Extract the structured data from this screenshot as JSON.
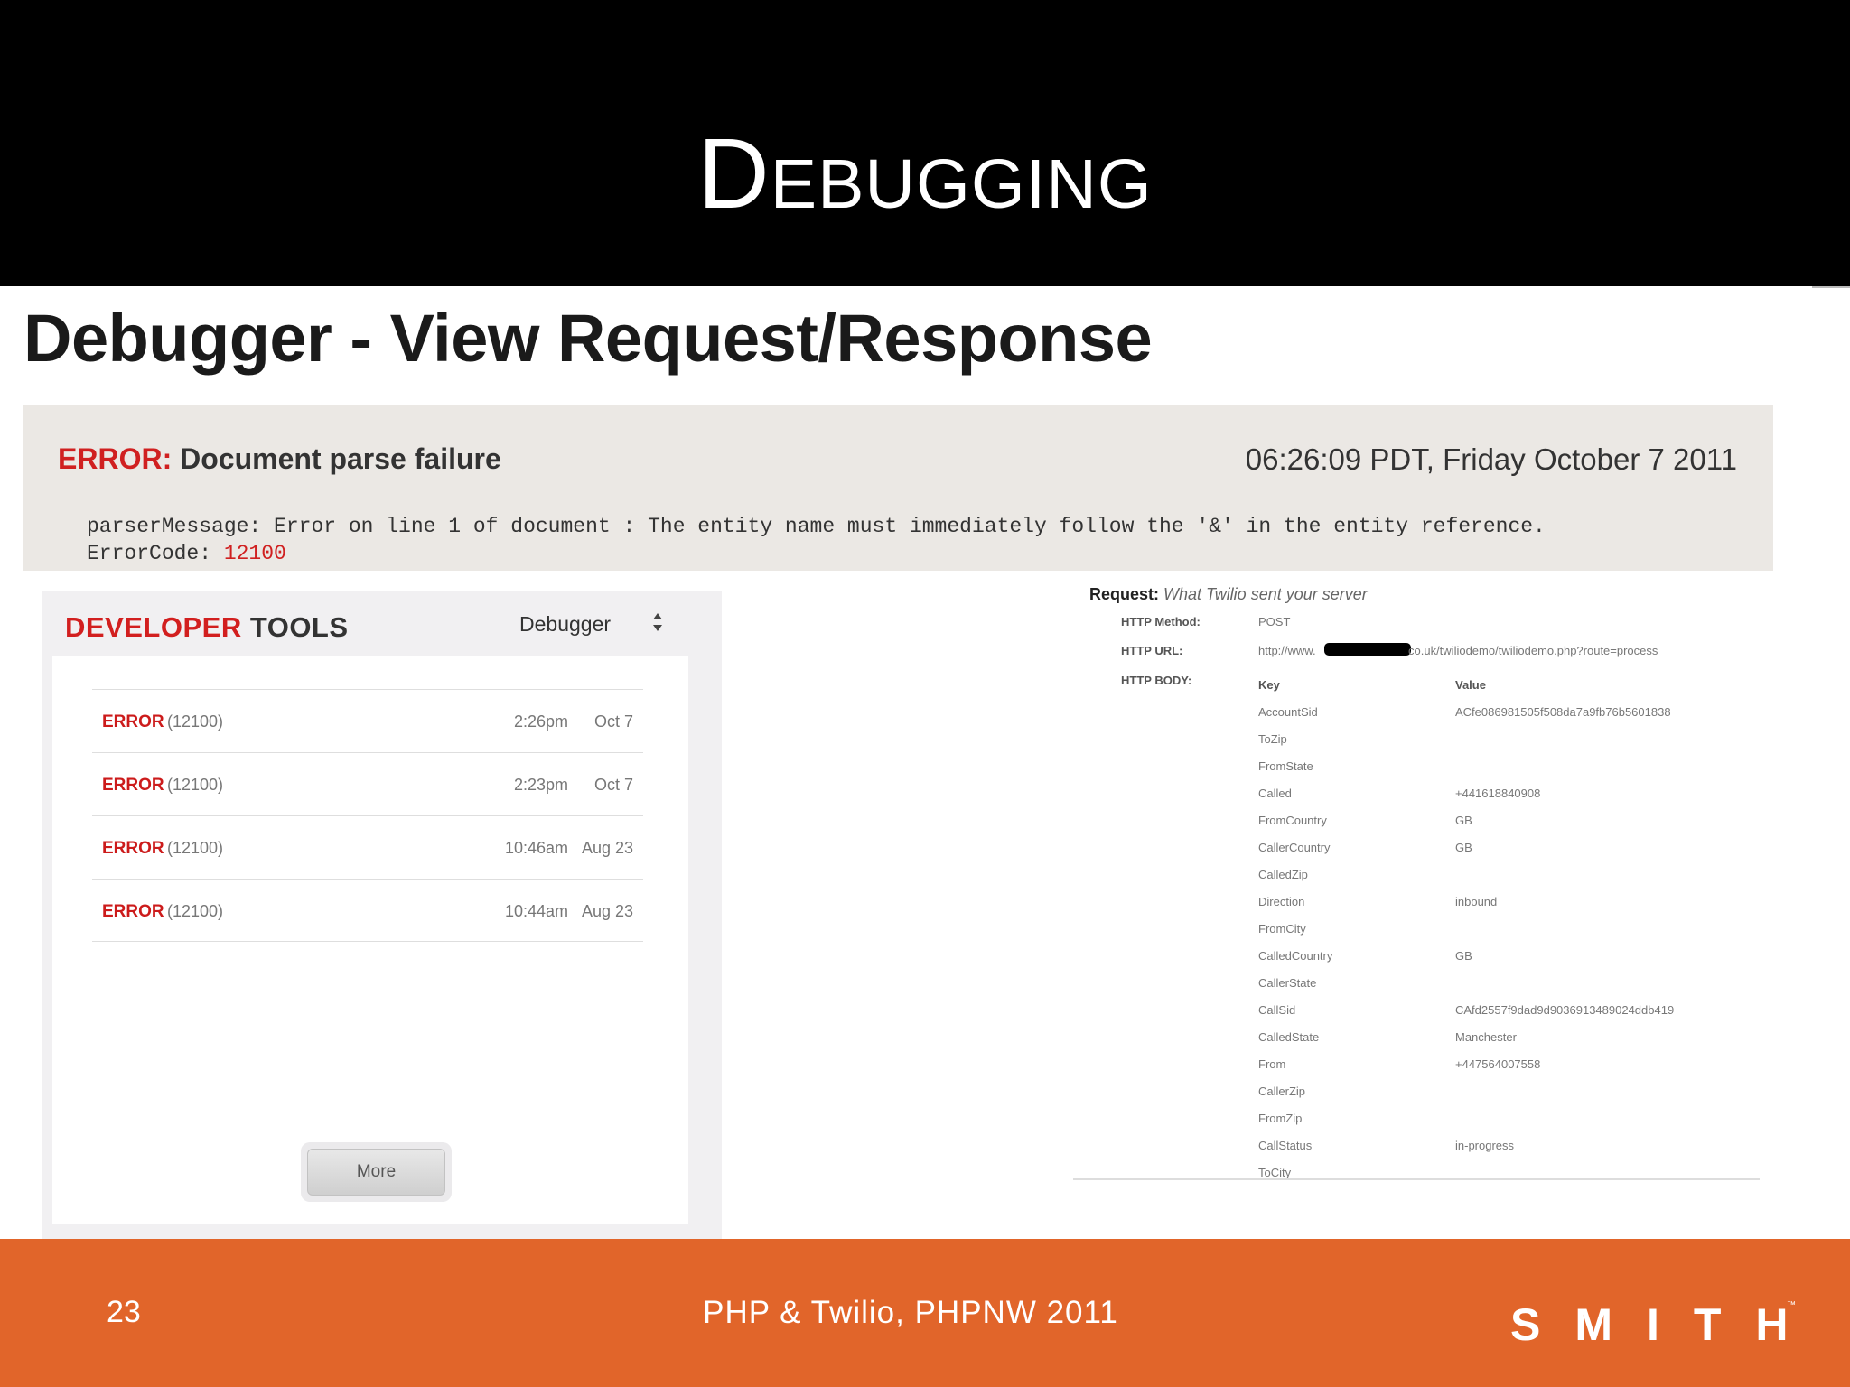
{
  "slide": {
    "title": "Debugging",
    "page_number": "23",
    "footer_text": "PHP & Twilio, PHPNW 2011",
    "logo_text": "SMITH",
    "trademark": "™",
    "colors": {
      "title_bar": "#000000",
      "footer": "#e1652a",
      "error_red": "#d02020"
    }
  },
  "screenshot": {
    "heading": "Debugger - View Request/Response"
  },
  "error_panel": {
    "label": "ERROR:",
    "title": " Document parse failure",
    "timestamp": "06:26:09 PDT, Friday October 7 2011",
    "message_line": "parserMessage: Error on line 1 of document : The entity name must immediately follow the '&' in the entity reference.",
    "code_label": "ErrorCode: ",
    "code_value": "12100"
  },
  "dev_tools": {
    "title_red": "DEVELOPER",
    "title_rest": " TOOLS",
    "select_value": "Debugger",
    "select_icon": "up-down-arrows-icon",
    "errors": [
      {
        "label": "ERROR",
        "code": "(12100)",
        "time": "2:26pm",
        "date": "Oct 7"
      },
      {
        "label": "ERROR",
        "code": "(12100)",
        "time": "2:23pm",
        "date": "Oct 7"
      },
      {
        "label": "ERROR",
        "code": "(12100)",
        "time": "10:46am",
        "date": "Aug 23"
      },
      {
        "label": "ERROR",
        "code": "(12100)",
        "time": "10:44am",
        "date": "Aug 23"
      }
    ],
    "more_label": "More"
  },
  "request": {
    "heading_bold": "Request:",
    "heading_italic": " What Twilio sent your server",
    "method_label": "HTTP Method:",
    "method_value": "POST",
    "url_label": "HTTP URL:",
    "url_start": "http://www.",
    "url_end": "co.uk/twiliodemo/twiliodemo.php?route=process",
    "body_label": "HTTP BODY:",
    "key_header": "Key",
    "value_header": "Value",
    "params": [
      {
        "k": "AccountSid",
        "v": "ACfe086981505f508da7a9fb76b5601838"
      },
      {
        "k": "ToZip",
        "v": ""
      },
      {
        "k": "FromState",
        "v": ""
      },
      {
        "k": "Called",
        "v": "+441618840908"
      },
      {
        "k": "FromCountry",
        "v": "GB"
      },
      {
        "k": "CallerCountry",
        "v": "GB"
      },
      {
        "k": "CalledZip",
        "v": ""
      },
      {
        "k": "Direction",
        "v": "inbound"
      },
      {
        "k": "FromCity",
        "v": ""
      },
      {
        "k": "CalledCountry",
        "v": "GB"
      },
      {
        "k": "CallerState",
        "v": ""
      },
      {
        "k": "CallSid",
        "v": "CAfd2557f9dad9d9036913489024ddb419"
      },
      {
        "k": "CalledState",
        "v": "Manchester"
      },
      {
        "k": "From",
        "v": "+447564007558"
      },
      {
        "k": "CallerZip",
        "v": ""
      },
      {
        "k": "FromZip",
        "v": ""
      },
      {
        "k": "CallStatus",
        "v": "in-progress"
      },
      {
        "k": "ToCity",
        "v": ""
      }
    ]
  }
}
